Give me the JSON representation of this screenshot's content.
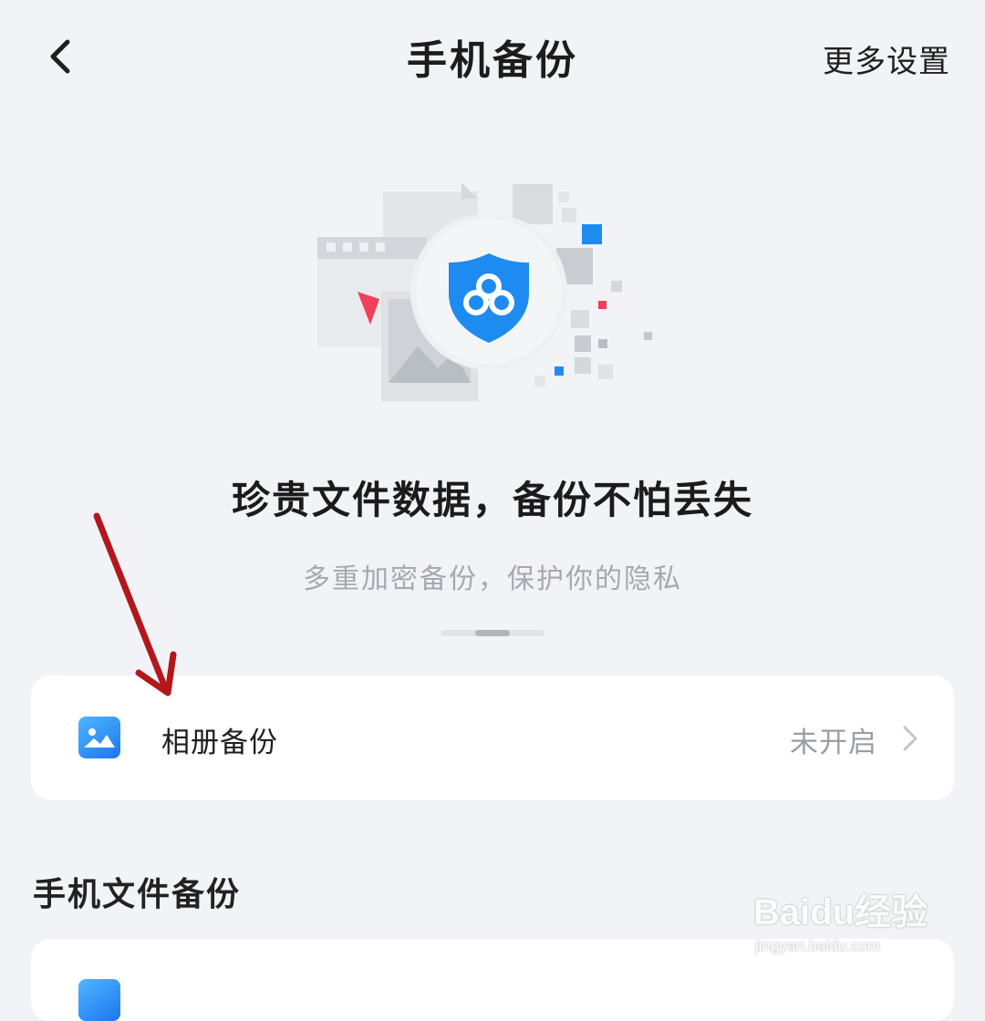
{
  "header": {
    "title": "手机备份",
    "more_settings": "更多设置"
  },
  "hero": {
    "headline": "珍贵文件数据，备份不怕丢失",
    "subline": "多重加密备份，保护你的隐私",
    "pager": {
      "pages": 3,
      "active": 2
    }
  },
  "album_backup": {
    "label": "相册备份",
    "status": "未开启",
    "icon": "photo-album-icon"
  },
  "phone_file_backup": {
    "section_title": "手机文件备份"
  },
  "watermark": {
    "logo": "Baidu经验",
    "url": "jingyan.baidu.com"
  },
  "colors": {
    "background": "#f2f3f7",
    "card": "#ffffff",
    "accent_blue": "#1e8bf0",
    "annotation_arrow": "#b3171b",
    "status_grey": "#9a9da4"
  }
}
